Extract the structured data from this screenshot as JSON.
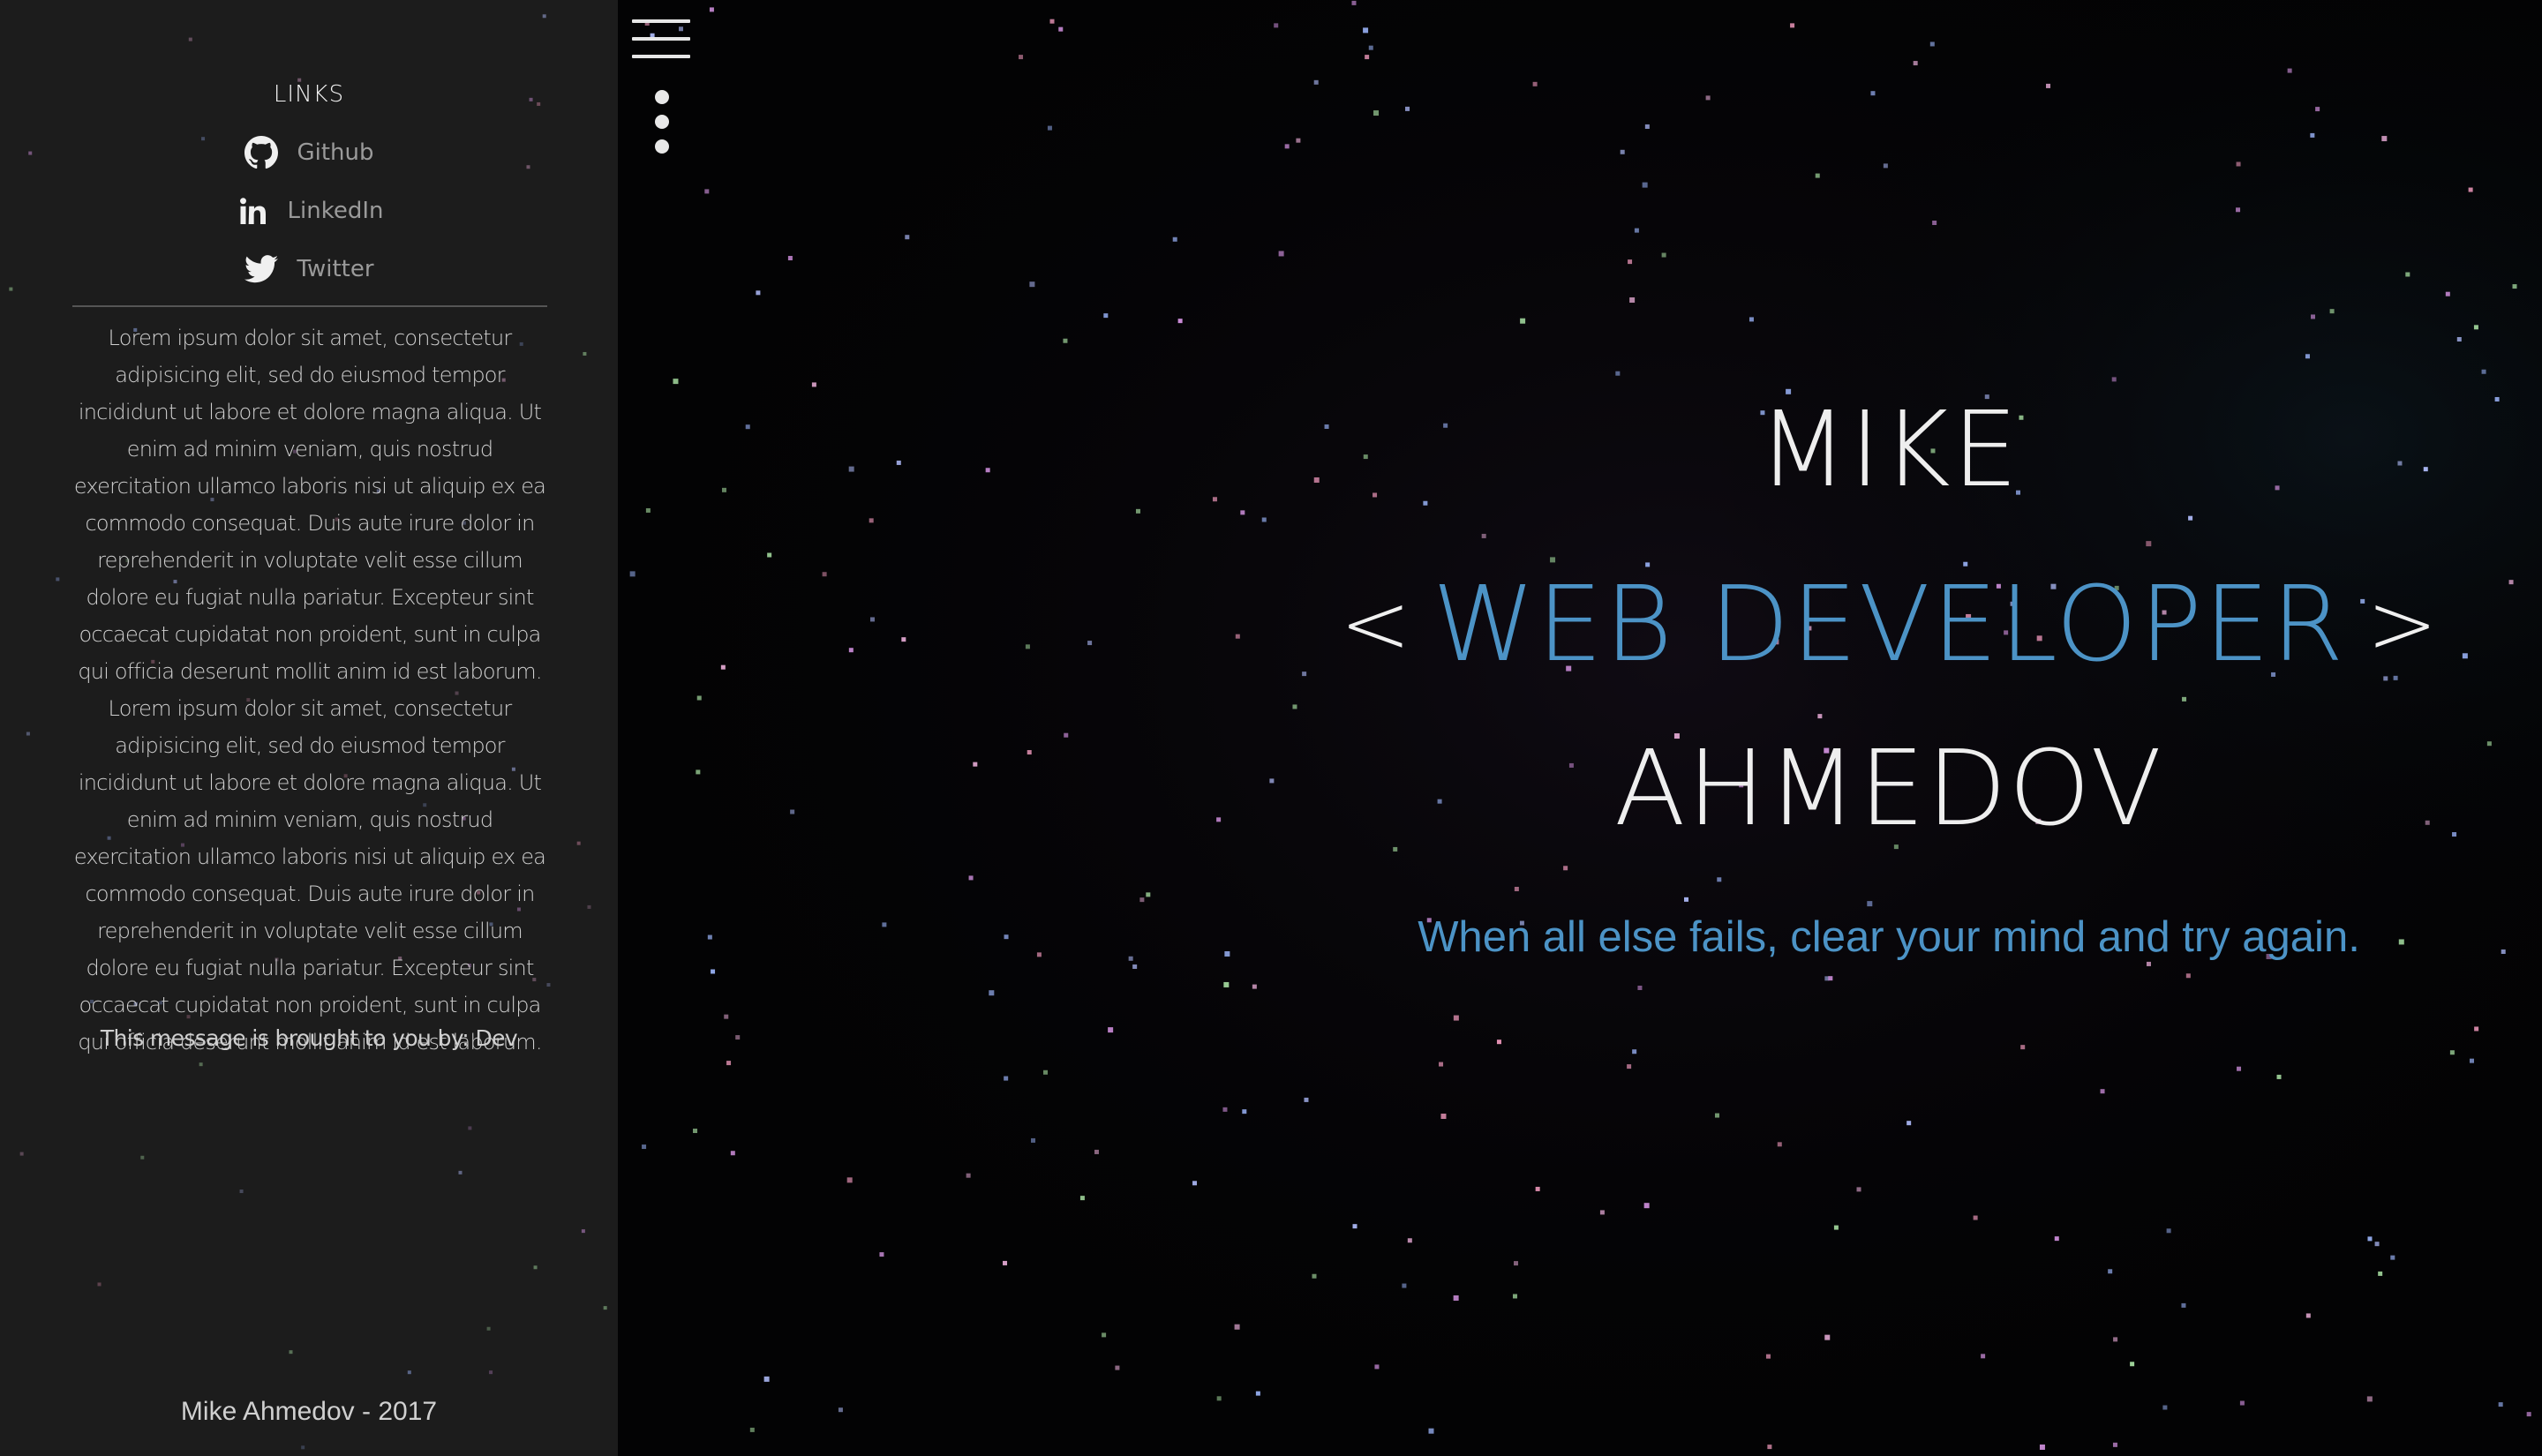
{
  "sidebar": {
    "heading": "LINKS",
    "links": [
      {
        "label": "Github",
        "icon": "github-icon"
      },
      {
        "label": "LinkedIn",
        "icon": "linkedin-icon"
      },
      {
        "label": "Twitter",
        "icon": "twitter-icon"
      }
    ],
    "paragraph_1": "Lorem ipsum dolor sit amet, consectetur adipisicing elit, sed do eiusmod tempor incididunt ut labore et dolore magna aliqua. Ut enim ad minim veniam, quis nostrud exercitation ullamco laboris nisi ut aliquip ex ea commodo consequat. Duis aute irure dolor in reprehenderit in voluptate velit esse cillum dolore eu fugiat nulla pariatur. Excepteur sint occaecat cupidatat non proident, sunt in culpa qui officia deserunt mollit anim id est laborum.",
    "paragraph_2": "Lorem ipsum dolor sit amet, consectetur adipisicing elit, sed do eiusmod tempor incididunt ut labore et dolore magna aliqua. Ut enim ad minim veniam, quis nostrud exercitation ullamco laboris nisi ut aliquip ex ea commodo consequat. Duis aute irure dolor in reprehenderit in voluptate velit esse cillum dolore eu fugiat nulla pariatur. Excepteur sint occaecat cupidatat non proident, sunt in culpa qui officia deserunt mollit anim id est laborum.",
    "message": "This message is brought to you by: Dev",
    "footer": "Mike Ahmedov - 2017"
  },
  "controls": {
    "menu_icon": "hamburger-menu-icon",
    "more_icon": "vertical-dots-icon"
  },
  "hero": {
    "first_name": "MIKE",
    "bracket_open": "<",
    "title": "WEB DEVELOPER",
    "bracket_close": ">",
    "last_name": "AHMEDOV",
    "tagline": "When all else fails, clear your mind and try again."
  },
  "colors": {
    "accent": "#4c93c6",
    "background": "#030304",
    "sidebar": "#1c1c1c",
    "star_palette": [
      "#c98bd6",
      "#e08fb0",
      "#8fa6e6",
      "#9fd49a",
      "#d8a0c8",
      "#a8b4f0"
    ]
  }
}
